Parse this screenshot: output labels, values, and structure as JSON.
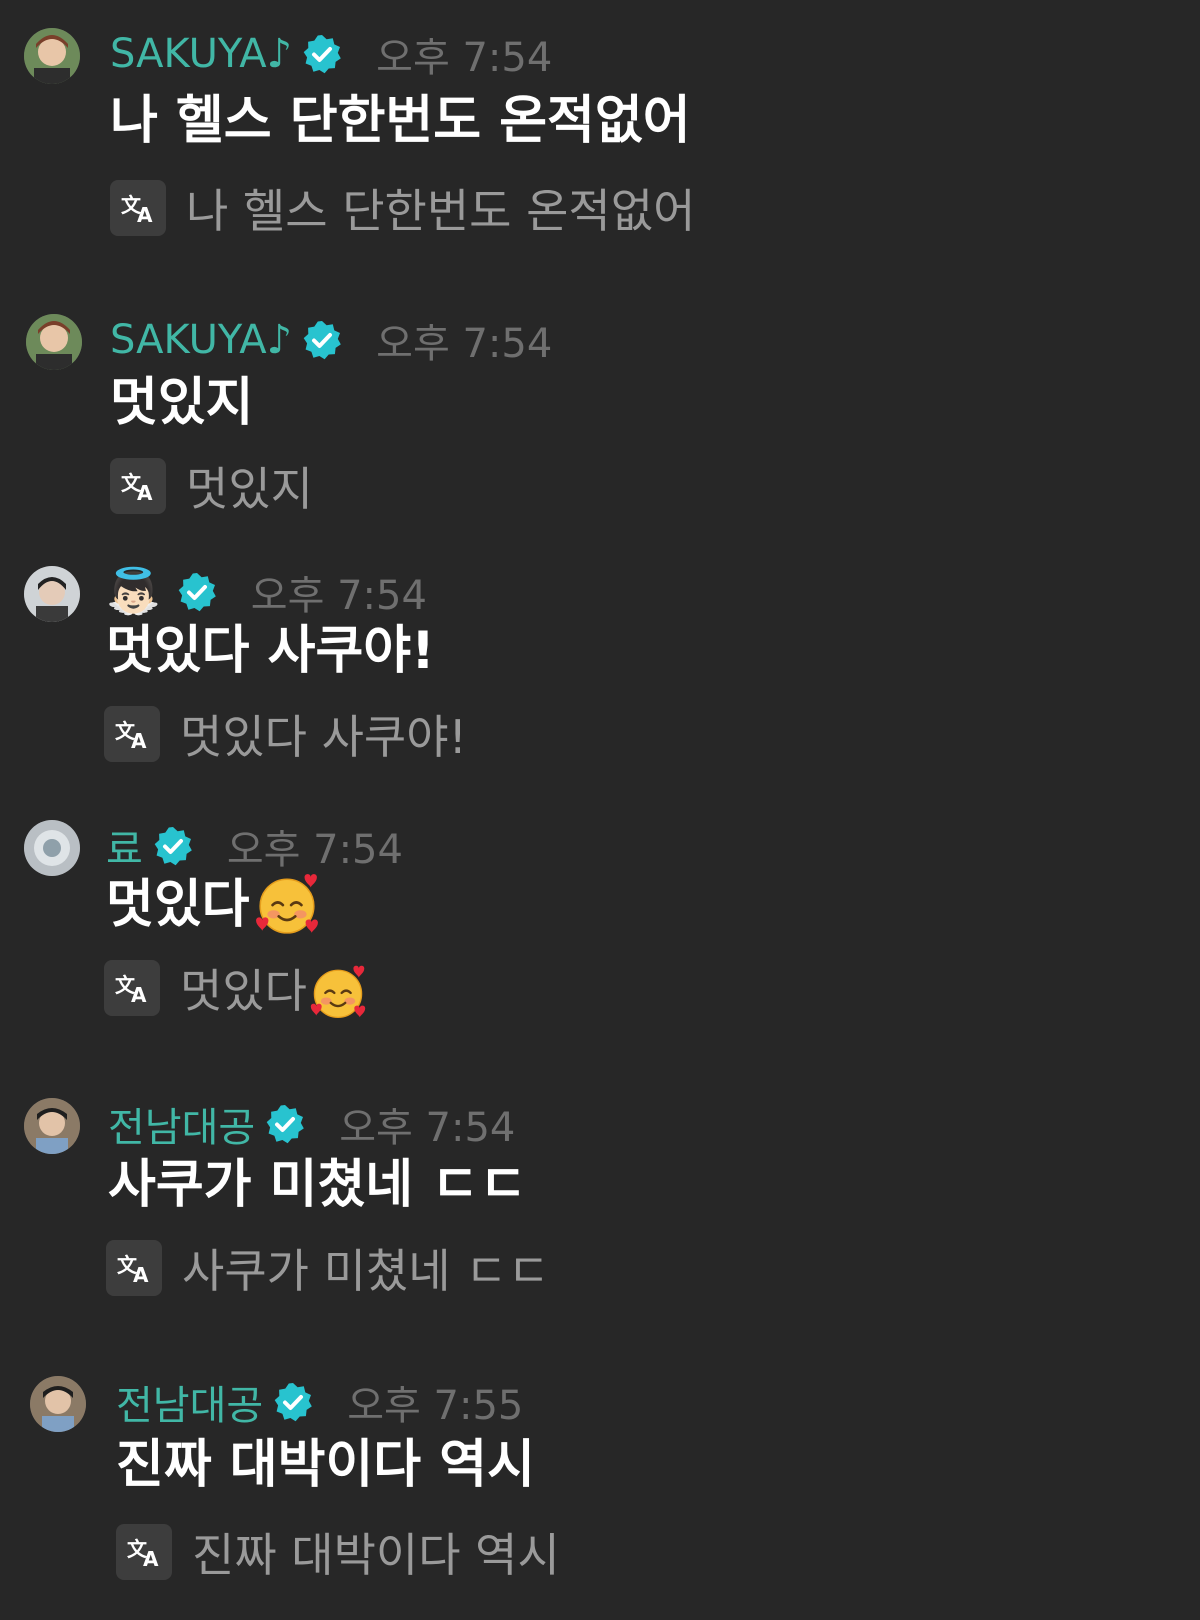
{
  "colors": {
    "background": "#272727",
    "name": "#41b7a6",
    "badge": "#28c3cf",
    "time": "#6f6f6f",
    "translation": "#9a9a9a"
  },
  "messages": [
    {
      "author": "SAKUYA♪",
      "verified": true,
      "time": "오후 7:54",
      "text": "나 헬스 단한번도 온적없어",
      "translation": "나 헬스 단한번도 온적없어"
    },
    {
      "author": "SAKUYA♪",
      "verified": true,
      "time": "오후 7:54",
      "text": "멋있지",
      "translation": "멋있지"
    },
    {
      "author": "👼🏻",
      "verified": true,
      "time": "오후 7:54",
      "text": "멋있다 사쿠야!",
      "translation": "멋있다 사쿠야!"
    },
    {
      "author": "료",
      "verified": true,
      "time": "오후 7:54",
      "text": "멋있다",
      "text_emoji": "smiling-face-with-hearts",
      "translation": "멋있다",
      "translation_emoji": "smiling-face-with-hearts"
    },
    {
      "author": "전남대공",
      "verified": true,
      "time": "오후 7:54",
      "text": "사쿠가 미쳤네 ㄷㄷ",
      "translation": "사쿠가 미쳤네 ㄷㄷ"
    },
    {
      "author": "전남대공",
      "verified": true,
      "time": "오후 7:55",
      "text": "진짜 대박이다 역시",
      "translation": "진짜 대박이다 역시"
    }
  ],
  "icons": {
    "verified": "verified-badge-icon",
    "translate": "translate-icon",
    "avatar": "user-avatar"
  }
}
